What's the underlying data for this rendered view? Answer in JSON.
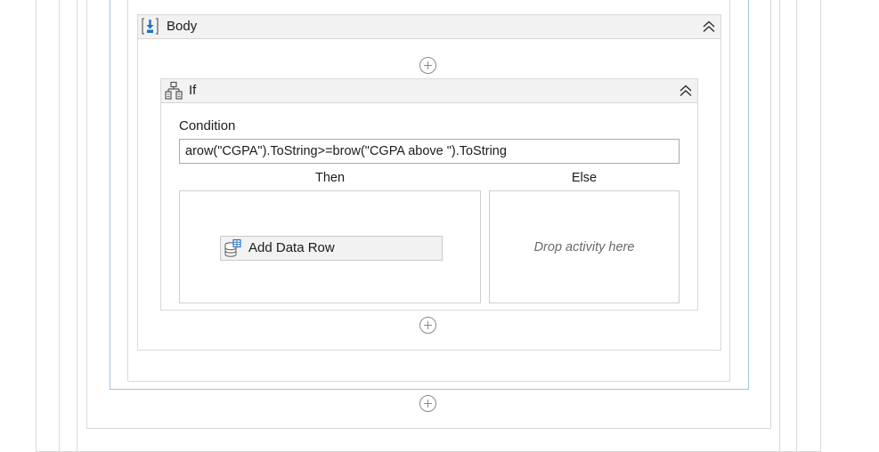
{
  "body_container": {
    "title": "Body",
    "icon": "body-sequence-icon",
    "collapse_icon": "double-chevron-up-icon"
  },
  "if_activity": {
    "title": "If",
    "icon": "if-branch-icon",
    "collapse_icon": "double-chevron-up-icon",
    "condition_label": "Condition",
    "condition_value": "arow(\"CGPA\").ToString>=brow(\"CGPA  above \").ToString",
    "then_label": "Then",
    "else_label": "Else",
    "then_activity": {
      "label": "Add Data Row",
      "icon": "add-data-row-icon"
    },
    "else_placeholder": "Drop activity here"
  },
  "add_activity_icon": "add-activity-plus-icon",
  "colors": {
    "header_bg": "#f2f2f2",
    "border": "#d9d9d9",
    "selected_border": "#9fc3e6",
    "icon_blue": "#1f6fc5"
  }
}
